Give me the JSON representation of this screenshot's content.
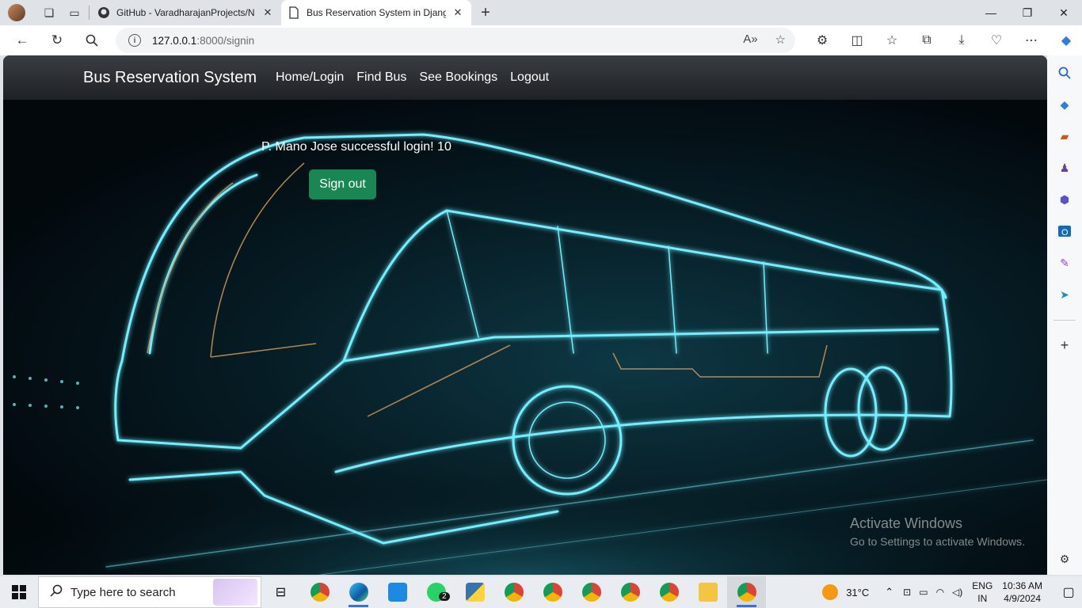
{
  "browser": {
    "tabs": [
      {
        "title": "GitHub - VaradharajanProjects/N",
        "active": false
      },
      {
        "title": "Bus Reservation System in Djang",
        "active": true
      }
    ],
    "url_host": "127.0.0.1",
    "url_path": ":8000/signin"
  },
  "site": {
    "brand": "Bus Reservation System",
    "nav": [
      "Home/Login",
      "Find Bus",
      "See Bookings",
      "Logout"
    ],
    "message": "P. Mano Jose successful login! 10",
    "signout_label": "Sign out"
  },
  "watermark": {
    "line1": "Activate Windows",
    "line2": "Go to Settings to activate Windows."
  },
  "taskbar": {
    "search_placeholder": "Type here to search",
    "whatsapp_badge": "2",
    "temperature": "31°C",
    "lang1": "ENG",
    "lang2": "IN",
    "time": "10:36 AM",
    "date": "4/9/2024"
  },
  "colors": {
    "signout_bg": "#198754",
    "navbar_bg": "#2b2f33",
    "neon": "#5fe6ff"
  }
}
